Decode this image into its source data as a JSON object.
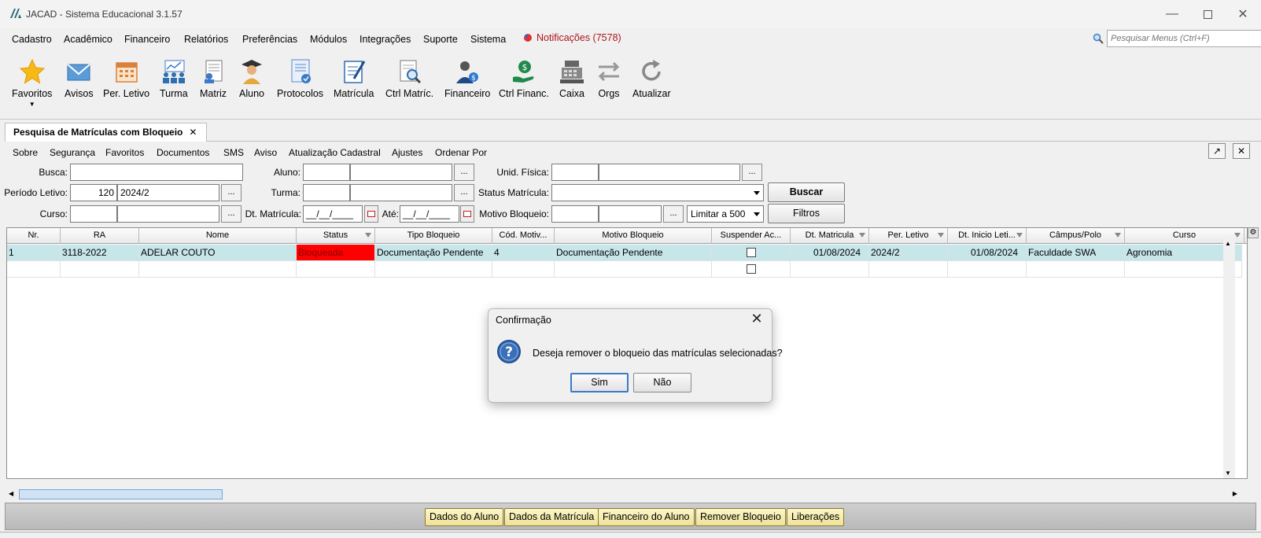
{
  "app": {
    "title": "JACAD - Sistema Educacional 3.1.57"
  },
  "menu": {
    "items": [
      "Cadastro",
      "Acadêmico",
      "Financeiro",
      "Relatórios",
      "Preferências",
      "Módulos",
      "Integrações",
      "Suporte",
      "Sistema"
    ],
    "notifications": "Notificações (7578)",
    "search_placeholder": "Pesquisar Menus (Ctrl+F)"
  },
  "toolbar": {
    "items": [
      "Favoritos",
      "Avisos",
      "Per. Letivo",
      "Turma",
      "Matriz",
      "Aluno",
      "Protocolos",
      "Matrícula",
      "Ctrl Matríc.",
      "Financeiro",
      "Ctrl Financ.",
      "Caixa",
      "Orgs",
      "Atualizar"
    ],
    "icons": [
      "star-icon",
      "envelope-icon",
      "calendar-icon",
      "class-icon",
      "matrix-icon",
      "student-icon",
      "protocol-icon",
      "enrollment-icon",
      "search-doc-icon",
      "finance-person-icon",
      "money-hand-icon",
      "cash-register-icon",
      "swap-arrows-icon",
      "refresh-icon"
    ]
  },
  "tab": {
    "label": "Pesquisa de Matrículas com Bloqueio",
    "close": "✕"
  },
  "submenu": [
    "Sobre",
    "Segurança",
    "Favoritos",
    "Documentos",
    "SMS",
    "Aviso",
    "Atualização Cadastral",
    "Ajustes",
    "Ordenar Por"
  ],
  "form": {
    "busca_label": "Busca:",
    "busca_value": "",
    "periodo_label": "Período Letivo:",
    "periodo_code": "120",
    "periodo_value": "2024/2",
    "curso_label": "Curso:",
    "aluno_label": "Aluno:",
    "turma_label": "Turma:",
    "dtmatricula_label": "Dt. Matrícula:",
    "dtmatricula_value": "__/__/____",
    "ate_label": "Até:",
    "ate_value": "__/__/____",
    "unid_label": "Unid. Física:",
    "status_label": "Status Matrícula:",
    "status_value": "",
    "motivo_label": "Motivo Bloqueio:",
    "limit_value": "Limitar a 500",
    "dots": "...",
    "buscar_button": "Buscar",
    "filtros_button": "Filtros"
  },
  "grid": {
    "columns": [
      "Nr.",
      "RA",
      "Nome",
      "Status",
      "Tipo Bloqueio",
      "Cód. Motiv...",
      "Motivo Bloqueio",
      "Suspender Ac...",
      "Dt. Matricula",
      "Per. Letivo",
      "Dt. Inicio Leti...",
      "Câmpus/Polo",
      "Curso"
    ],
    "rows": [
      {
        "nr": "1",
        "ra": "3118-2022",
        "nome": "ADELAR COUTO",
        "status": "Bloqueada",
        "tipo": "Documentação Pendente",
        "cod": "4",
        "motivo": "Documentação Pendente",
        "suspender": false,
        "dt_matricula": "01/08/2024",
        "per_letivo": "2024/2",
        "dt_inicio": "01/08/2024",
        "campus": "Faculdade SWA",
        "curso": "Agronomia"
      }
    ]
  },
  "bottom_buttons": [
    "Dados do Aluno",
    "Dados da Matrícula",
    "Financeiro do Aluno",
    "Remover Bloqueio",
    "Liberações"
  ],
  "dialog": {
    "title": "Confirmação",
    "message": "Deseja remover o bloqueio das matrículas selecionadas?",
    "yes": "Sim",
    "no": "Não",
    "close": "✕"
  },
  "colors": {
    "selected_row": "#c7e6ea",
    "blocked_status": "#ff0000",
    "notification": "#b0141e"
  }
}
